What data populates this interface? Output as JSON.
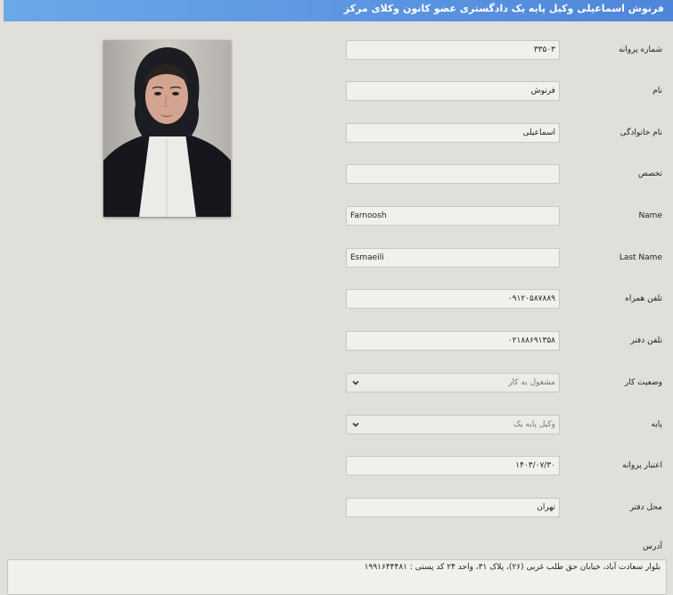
{
  "header": {
    "title": "فرنوش اسماعیلی وکیل پایه یک دادگستری عضو کانون وکلای مرکز"
  },
  "form": {
    "license_number": {
      "label": "شماره پروانه",
      "value": "۳۳۵۰۳"
    },
    "first_name": {
      "label": "نام",
      "value": "فرنوش"
    },
    "last_name": {
      "label": "نام خانوادگی",
      "value": "اسماعیلی"
    },
    "specialty": {
      "label": "تخصص",
      "value": ""
    },
    "name_en": {
      "label": "Name",
      "value": "Farnoosh"
    },
    "last_name_en": {
      "label": "Last Name",
      "value": "Esmaeili"
    },
    "mobile": {
      "label": "تلفن همراه",
      "value": "۰۹۱۲۰۵۸۷۸۸۹"
    },
    "office_phone": {
      "label": "تلفن دفتر",
      "value": "۰۲۱۸۸۶۹۱۳۵۸"
    },
    "work_status": {
      "label": "وضعیت کار",
      "value": "مشغول به کار"
    },
    "grade": {
      "label": "پایه",
      "value": "وکیل پایه یک"
    },
    "license_validity": {
      "label": "اعتبار پروانه",
      "value": "۱۴۰۳/۰۷/۳۰"
    },
    "office_location": {
      "label": "محل دفتر",
      "value": "تهران"
    },
    "address": {
      "label": "آدرس",
      "value": "بلوار سعادت آباد، خیابان حق طلب غربی (۲۶)، پلاک ۳۱، واحد ۲۴ کد پستی : ۱۹۹۱۶۴۴۴۸۱"
    }
  },
  "icons": {
    "dropdown": "chevron-down-icon"
  },
  "colors": {
    "header_start": "#6aa8e8",
    "header_end": "#4f86d9",
    "background": "#e1dfda",
    "field": "#f1f0ec"
  }
}
